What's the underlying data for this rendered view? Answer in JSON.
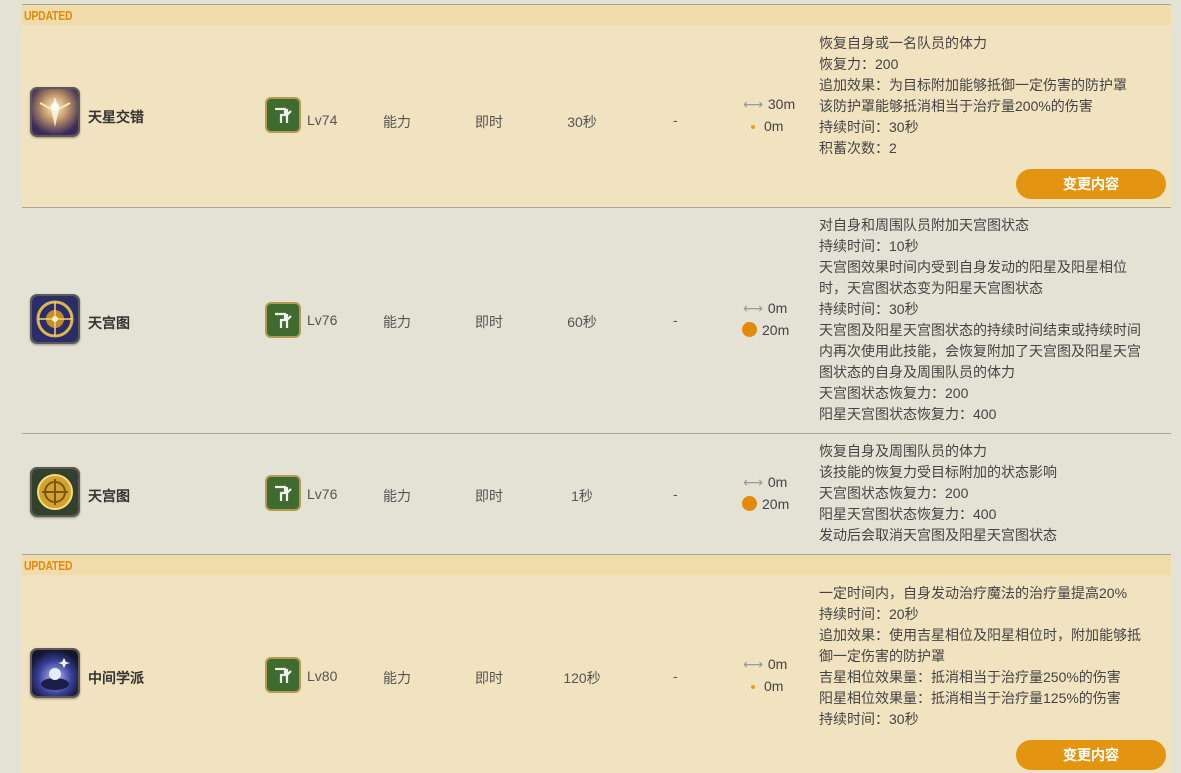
{
  "updated_label": "UPDATED",
  "change_button_label": "变更内容",
  "skills": [
    {
      "name": "天星交错",
      "icon": "astral-crossing-skill-icon",
      "level": "Lv74",
      "type": "能力",
      "cast": "即时",
      "recast": "30秒",
      "cost": "-",
      "range": "30m",
      "radius": "0m",
      "description": [
        "恢复自身或一名队员的体力",
        "恢复力：200",
        "追加效果：为目标附加能够抵御一定伤害的防护罩",
        "该防护罩能够抵消相当于治疗量200%的伤害",
        "持续时间：30秒",
        "积蓄次数：2"
      ],
      "updated": true
    },
    {
      "name": "天宫图",
      "icon": "horoscope-skill-icon",
      "level": "Lv76",
      "type": "能力",
      "cast": "即时",
      "recast": "60秒",
      "cost": "-",
      "range": "0m",
      "radius": "20m",
      "description": [
        "对自身和周围队员附加天宫图状态",
        "持续时间：10秒",
        "天宫图效果时间内受到自身发动的阳星及阳星相位",
        "时，天宫图状态变为阳星天宫图状态",
        "持续时间：30秒",
        "天宫图及阳星天宫图状态的持续时间结束或持续时间",
        "内再次使用此技能，会恢复附加了天宫图及阳星天宫",
        "图状态的自身及周围队员的体力",
        "天宫图状态恢复力：200",
        "阳星天宫图状态恢复力：400"
      ],
      "updated": false
    },
    {
      "name": "天宫图",
      "icon": "horoscope-heal-skill-icon",
      "level": "Lv76",
      "type": "能力",
      "cast": "即时",
      "recast": "1秒",
      "cost": "-",
      "range": "0m",
      "radius": "20m",
      "description": [
        "恢复自身及周围队员的体力",
        "该技能的恢复力受目标附加的状态影响",
        "天宫图状态恢复力：200",
        "阳星天宫图状态恢复力：400",
        "发动后会取消天宫图及阳星天宫图状态"
      ],
      "updated": false
    },
    {
      "name": "中间学派",
      "icon": "neutral-sect-skill-icon",
      "level": "Lv80",
      "type": "能力",
      "cast": "即时",
      "recast": "120秒",
      "cost": "-",
      "range": "0m",
      "radius": "0m",
      "description": [
        "一定时间内，自身发动治疗魔法的治疗量提高20%",
        "持续时间：20秒",
        "追加效果：使用吉星相位及阳星相位时，附加能够抵",
        "御一定伤害的防护罩",
        "吉星相位效果量：抵消相当于治疗量250%的伤害",
        "阳星相位效果量：抵消相当于治疗量125%的伤害",
        "持续时间：30秒"
      ],
      "updated": true
    }
  ]
}
